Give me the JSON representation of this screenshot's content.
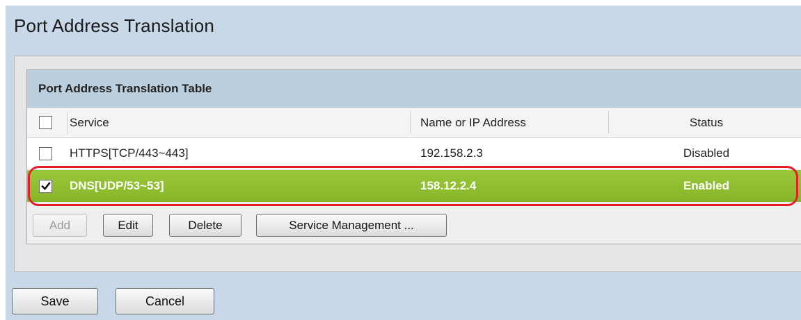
{
  "page": {
    "title": "Port Address Translation"
  },
  "table": {
    "title": "Port Address Translation Table",
    "columns": {
      "service": "Service",
      "ip": "Name or IP Address",
      "status": "Status"
    },
    "rows": [
      {
        "service": "HTTPS[TCP/443~443]",
        "ip": "192.158.2.3",
        "status": "Disabled",
        "checked": false
      },
      {
        "service": "DNS[UDP/53~53]",
        "ip": "158.12.2.4",
        "status": "Enabled",
        "checked": true
      }
    ],
    "buttons": {
      "add": "Add",
      "edit": "Edit",
      "delete": "Delete",
      "service_management": "Service Management ..."
    }
  },
  "footer": {
    "save": "Save",
    "cancel": "Cancel"
  },
  "colors": {
    "page_background": "#c8d8e8",
    "selected_row": "#8fbe2f",
    "highlight_ring": "#e3202a"
  },
  "icons": {
    "checkmark": "checkmark-icon"
  }
}
